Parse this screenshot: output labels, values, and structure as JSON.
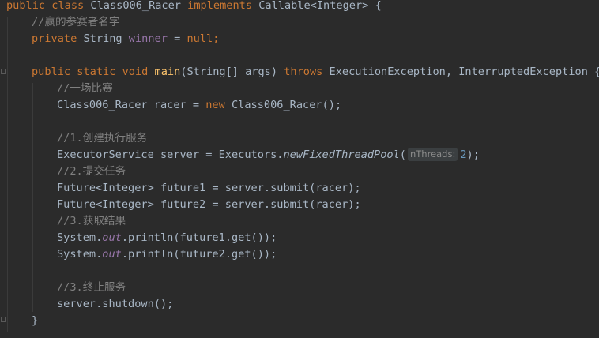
{
  "lines": {
    "l1": {
      "kw1": "public",
      "kw2": "class",
      "name": "Class006_Racer",
      "kw3": "implements",
      "rest": "Callable<Integer> {"
    },
    "l2": {
      "comment": "//赢的参赛者名字"
    },
    "l3": {
      "kw1": "private",
      "type": "String",
      "field": "winner",
      "eq": " = ",
      "kw2": "null",
      "end": ";"
    },
    "l5": {
      "kw1": "public",
      "kw2": "static",
      "kw3": "void",
      "fn": "main",
      "params": "(String[] args)",
      "kw4": "throws",
      "rest": "ExecutionException, InterruptedException {"
    },
    "l6": {
      "comment": "//一场比赛"
    },
    "l7": {
      "pre": "Class006_Racer racer = ",
      "kw": "new",
      "post": " Class006_Racer();"
    },
    "l9": {
      "comment": "//1.创建执行服务"
    },
    "l10": {
      "pre": "ExecutorService server = Executors.",
      "call": "newFixedThreadPool",
      "open": "(",
      "hint": "nThreads:",
      "num": "2",
      "close": ");"
    },
    "l11": {
      "comment": "//2.提交任务"
    },
    "l12": {
      "text": "Future<Integer> future1 = server.submit(racer);"
    },
    "l13": {
      "text": "Future<Integer> future2 = server.submit(racer);"
    },
    "l14": {
      "comment": "//3.获取结果"
    },
    "l15": {
      "pre": "System.",
      "field": "out",
      "post": ".println(future1.get());"
    },
    "l16": {
      "pre": "System.",
      "field": "out",
      "post": ".println(future2.get());"
    },
    "l18": {
      "comment": "//3.终止服务"
    },
    "l19": {
      "text": "server.shutdown();"
    },
    "l20": {
      "text": "}"
    }
  }
}
